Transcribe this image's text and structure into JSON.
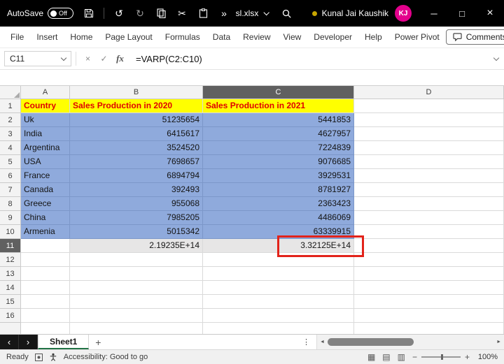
{
  "titlebar": {
    "autosave_label": "AutoSave",
    "autosave_state": "Off",
    "filename": "sl.xlsx",
    "user_name": "Kunal Jai Kaushik",
    "user_initials": "KJ"
  },
  "ribbon": {
    "tabs": [
      "File",
      "Insert",
      "Home",
      "Page Layout",
      "Formulas",
      "Data",
      "Review",
      "View",
      "Developer",
      "Help",
      "Power Pivot"
    ],
    "comments_label": "Comments"
  },
  "formula_bar": {
    "name_box": "C11",
    "formula": "=VARP(C2:C10)"
  },
  "sheet": {
    "columns": [
      "A",
      "B",
      "C",
      "D"
    ],
    "active_column": "C",
    "active_row": "11",
    "rows": [
      {
        "n": "1",
        "cells": [
          {
            "t": "Country",
            "s": "hdr"
          },
          {
            "t": "Sales Production in 2020",
            "s": "hdr"
          },
          {
            "t": "Sales Production in 2021",
            "s": "hdr"
          },
          {}
        ]
      },
      {
        "n": "2",
        "cells": [
          {
            "t": "Uk",
            "s": "data"
          },
          {
            "t": "51235654",
            "s": "data num"
          },
          {
            "t": "5441853",
            "s": "data num"
          },
          {}
        ]
      },
      {
        "n": "3",
        "cells": [
          {
            "t": "India",
            "s": "data"
          },
          {
            "t": "6415617",
            "s": "data num"
          },
          {
            "t": "4627957",
            "s": "data num"
          },
          {}
        ]
      },
      {
        "n": "4",
        "cells": [
          {
            "t": "Argentina",
            "s": "data"
          },
          {
            "t": "3524520",
            "s": "data num"
          },
          {
            "t": "7224839",
            "s": "data num"
          },
          {}
        ]
      },
      {
        "n": "5",
        "cells": [
          {
            "t": "USA",
            "s": "data"
          },
          {
            "t": "7698657",
            "s": "data num"
          },
          {
            "t": "9076685",
            "s": "data num"
          },
          {}
        ]
      },
      {
        "n": "6",
        "cells": [
          {
            "t": "France",
            "s": "data"
          },
          {
            "t": "6894794",
            "s": "data num"
          },
          {
            "t": "3929531",
            "s": "data num"
          },
          {}
        ]
      },
      {
        "n": "7",
        "cells": [
          {
            "t": "Canada",
            "s": "data"
          },
          {
            "t": "392493",
            "s": "data num"
          },
          {
            "t": "8781927",
            "s": "data num"
          },
          {}
        ]
      },
      {
        "n": "8",
        "cells": [
          {
            "t": "Greece",
            "s": "data"
          },
          {
            "t": "955068",
            "s": "data num"
          },
          {
            "t": "2363423",
            "s": "data num"
          },
          {}
        ]
      },
      {
        "n": "9",
        "cells": [
          {
            "t": "China",
            "s": "data"
          },
          {
            "t": "7985205",
            "s": "data num"
          },
          {
            "t": "4486069",
            "s": "data num"
          },
          {}
        ]
      },
      {
        "n": "10",
        "cells": [
          {
            "t": "Armenia",
            "s": "data"
          },
          {
            "t": "5015342",
            "s": "data num"
          },
          {
            "t": "63339915",
            "s": "data num"
          },
          {}
        ]
      },
      {
        "n": "11",
        "cells": [
          {},
          {
            "t": "2.19235E+14",
            "s": "result num"
          },
          {
            "t": "3.32125E+14",
            "s": "result num active"
          },
          {}
        ]
      },
      {
        "n": "12"
      },
      {
        "n": "13"
      },
      {
        "n": "14"
      },
      {
        "n": "15"
      },
      {
        "n": "16"
      },
      {
        "n": ""
      }
    ]
  },
  "sheet_bar": {
    "active_tab": "Sheet1"
  },
  "status_bar": {
    "ready": "Ready",
    "accessibility": "Accessibility: Good to go",
    "zoom": "100%"
  },
  "icons": {
    "undo": "↺",
    "redo": "↻",
    "cut": "✂",
    "more_chevrons": "»",
    "minimize": "─",
    "maximize": "□",
    "close": "×",
    "cancel": "×",
    "enter": "✓",
    "fx": "fx",
    "prev_sheet": "‹",
    "next_sheet": "›",
    "add_sheet": "+",
    "overflow_dots": "⋮",
    "scroll_left": "◄",
    "scroll_right": "►",
    "view_normal": "▦",
    "view_layout": "▤",
    "view_break": "▥",
    "zoom_out": "−",
    "zoom_in": "+"
  },
  "colors": {
    "titlebar_bg": "#000000",
    "header_fill": "#FFFF00",
    "header_text": "#E00000",
    "data_fill": "#8FAADC",
    "result_fill": "#E7E6E6",
    "annotation_red": "#E2231A",
    "accent_green": "#217346",
    "avatar_pink": "#E3008C"
  }
}
